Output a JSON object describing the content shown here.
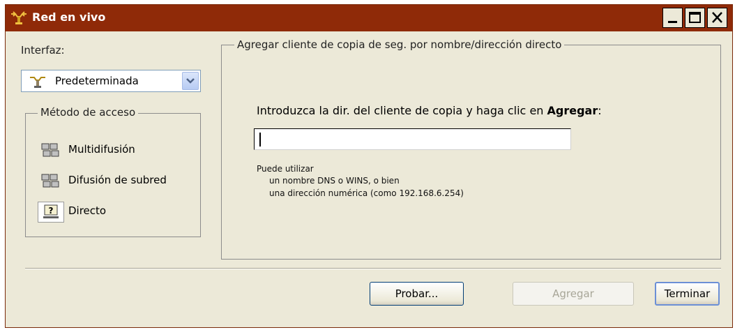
{
  "window": {
    "title": "Red en vivo",
    "accent": "#8f2a08"
  },
  "interface": {
    "label": "Interfaz:",
    "selected": "Predeterminada",
    "icon": "network-adapter-icon"
  },
  "access_method": {
    "legend": "Método de acceso",
    "items": [
      {
        "label": "Multidifusión",
        "icon": "computers-icon",
        "selected": false
      },
      {
        "label": "Difusión de subred",
        "icon": "computers-icon",
        "selected": false
      },
      {
        "label": "Directo",
        "icon": "question-computer-icon",
        "selected": true
      }
    ]
  },
  "direct": {
    "legend": "Agregar cliente de copia de seg. por nombre/dirección directo",
    "instruction_prefix": "Introduzca la dir. del cliente de copia y haga clic en ",
    "instruction_bold": "Agregar",
    "instruction_suffix": ":",
    "input_value": "",
    "hint_line1": "Puede utilizar",
    "hint_line2": "un nombre DNS o WINS, o bien",
    "hint_line3": "una dirección numérica (como 192.168.6.254)"
  },
  "buttons": {
    "probar": "Probar...",
    "agregar": "Agregar",
    "terminar": "Terminar"
  }
}
